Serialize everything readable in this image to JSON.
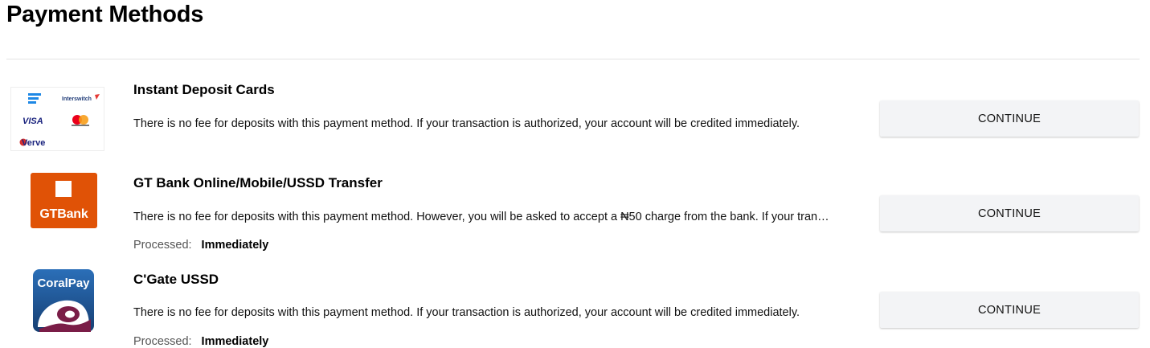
{
  "page": {
    "title": "Payment Methods"
  },
  "methods": [
    {
      "logo": "instant-deposit-cards-logo",
      "logo_text": [
        "Interswitch",
        "VISA",
        "Verve"
      ],
      "title": "Instant Deposit Cards",
      "description": "There is no fee for deposits with this payment method. If your transaction is authorized, your account will be credited immediately.",
      "button": "CONTINUE"
    },
    {
      "logo": "gtbank-logo",
      "logo_text": "GTBank",
      "title": "GT Bank Online/Mobile/USSD Transfer",
      "description": "There is no fee for deposits with this payment method. However, you will be asked to accept a ₦50 charge from the bank. If your transaction is authorized, your account will be credited immediately.",
      "processed_label": "Processed:",
      "processed_value": "Immediately",
      "button": "CONTINUE"
    },
    {
      "logo": "coralpay-logo",
      "logo_text": "CoralPay",
      "title": "C'Gate USSD",
      "description": "There is no fee for deposits with this payment method. If your transaction is authorized, your account will be credited immediately.",
      "processed_label": "Processed:",
      "processed_value": "Immediately",
      "button": "CONTINUE"
    }
  ],
  "colors": {
    "gtbank_orange": "#e05206",
    "coralpay_blue": "#1d5b9e",
    "coralpay_maroon": "#7a1d47",
    "button_bg": "#f3f4f6"
  }
}
